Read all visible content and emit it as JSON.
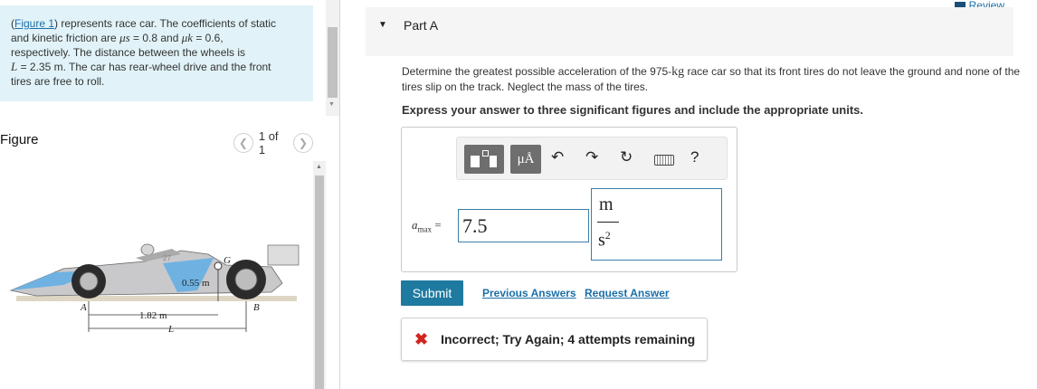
{
  "intro": {
    "figure_link": "Figure 1",
    "line1_rest": ") represents race car. The coefficients of static",
    "line2_pre": "and kinetic friction are ",
    "mu_s_symbol": "μs",
    "mu_s_value": " = 0.8 and ",
    "mu_k_symbol": "μk",
    "mu_k_value": " = 0.6,",
    "line3": "respectively. The distance between the wheels is",
    "line4_var": "L",
    "line4_rest": " = 2.35 m. The car has rear-wheel drive and the front",
    "line5": "tires are free to roll."
  },
  "figure": {
    "title": "Figure",
    "pager": "1 of 1",
    "labels": {
      "A": "A",
      "B": "B",
      "G": "G",
      "height": "0.55 m",
      "dist": "1.82 m",
      "L": "L",
      "car_number": "27"
    }
  },
  "review": "Review",
  "part": {
    "label": "Part A"
  },
  "question": {
    "text_pre": "Determine the greatest possible acceleration of the 975-",
    "unit_kg": "kg",
    "text_post": " race car so that its front tires do not leave the ground and none of the tires slip on the track. Neglect the mass of the tires.",
    "instruction": "Express your answer to three significant figures and include the appropriate units."
  },
  "toolbar": {
    "units_btn": "μÅ",
    "undo": "↶",
    "redo": "↷",
    "reset": "↻",
    "help": "?"
  },
  "answer": {
    "var": "a",
    "sub": "max",
    "eq": "=",
    "value": "7.5",
    "unit_num": "m",
    "unit_den": "s",
    "unit_den_exp": "2"
  },
  "actions": {
    "submit": "Submit",
    "previous_answers": "Previous Answers",
    "request_answer": "Request Answer"
  },
  "feedback": {
    "icon": "✖",
    "message": "Incorrect; Try Again; 4 attempts remaining"
  },
  "colors": {
    "accent": "#1f7aa0",
    "intro_bg": "#e1f3f8",
    "error": "#d0261f"
  }
}
